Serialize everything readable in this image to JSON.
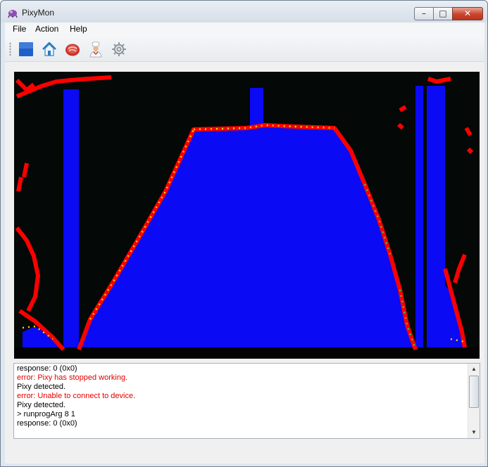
{
  "window": {
    "title": "PixyMon",
    "controls": {
      "minimize": "–",
      "maximize": "□",
      "close": "✕"
    }
  },
  "menubar": {
    "items": [
      "File",
      "Action",
      "Help"
    ]
  },
  "toolbar": {
    "buttons": [
      {
        "icon": "blue-square-icon"
      },
      {
        "icon": "home-icon"
      },
      {
        "icon": "raw-frame-icon"
      },
      {
        "icon": "chef-icon"
      },
      {
        "icon": "gear-icon"
      }
    ]
  },
  "colors": {
    "video_background": "#040806",
    "region_fill": "#0a0af5",
    "edge_red": "#ff0000",
    "edge_yellow": "#ffd400",
    "edge_green": "#2fd04a",
    "error_text": "#e60000"
  },
  "console": {
    "lines": [
      {
        "text": "response: 0 (0x0)",
        "kind": "normal"
      },
      {
        "text": "error: Pixy has stopped working.",
        "kind": "error"
      },
      {
        "text": "Pixy detected.",
        "kind": "normal"
      },
      {
        "text": "error: Unable to connect to device.",
        "kind": "error"
      },
      {
        "text": "Pixy detected.",
        "kind": "normal"
      },
      {
        "text": "> runprogArg 8 1",
        "kind": "normal"
      },
      {
        "text": "response: 0 (0x0)",
        "kind": "normal"
      }
    ]
  },
  "scrollbar": {
    "up": "▲",
    "down": "▼"
  }
}
